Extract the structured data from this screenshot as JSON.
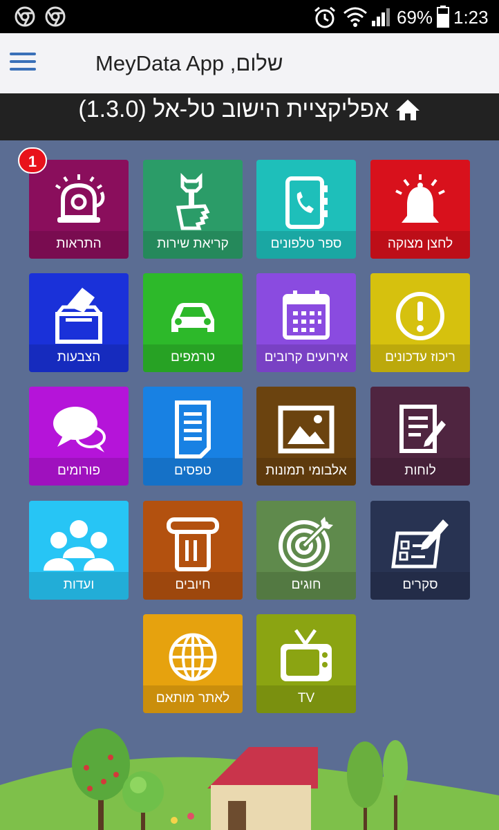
{
  "status_bar": {
    "battery": "69%",
    "time": "1:23"
  },
  "app_bar": {
    "title": "שלום, MeyData App"
  },
  "sub_header": {
    "title": "אפליקציית הישוב טל-אל (1.3.0)"
  },
  "badge": {
    "count": "1"
  },
  "tiles": [
    {
      "label": "לחצן מצוקה",
      "color": "#d8111c",
      "icon": "alarm-bell-icon"
    },
    {
      "label": "ספר טלפונים",
      "color": "#1ebfba",
      "icon": "phonebook-icon"
    },
    {
      "label": "קריאת שירות",
      "color": "#2b9c68",
      "icon": "wrench-hand-icon"
    },
    {
      "label": "התראות",
      "color": "#8a0e5c",
      "icon": "school-bell-icon"
    },
    {
      "label": "ריכוז עדכונים",
      "color": "#d6c10e",
      "icon": "exclamation-icon"
    },
    {
      "label": "אירועים קרובים",
      "color": "#8a4be0",
      "icon": "calendar-icon"
    },
    {
      "label": "טרמפים",
      "color": "#2db92a",
      "icon": "car-icon"
    },
    {
      "label": "הצבעות",
      "color": "#1a31d9",
      "icon": "ballot-box-icon"
    },
    {
      "label": "לוחות",
      "color": "#4f2540",
      "icon": "notepad-icon"
    },
    {
      "label": "אלבומי תמונות",
      "color": "#6b430f",
      "icon": "picture-icon"
    },
    {
      "label": "טפסים",
      "color": "#1881e3",
      "icon": "document-icon"
    },
    {
      "label": "פורומים",
      "color": "#b514d9",
      "icon": "speech-bubbles-icon"
    },
    {
      "label": "סקרים",
      "color": "#283352",
      "icon": "survey-icon"
    },
    {
      "label": "חוגים",
      "color": "#5f8a4c",
      "icon": "target-icon"
    },
    {
      "label": "חיובים",
      "color": "#b3510f",
      "icon": "receipt-icon"
    },
    {
      "label": "ועדות",
      "color": "#27c5f5",
      "icon": "group-icon"
    },
    {
      "label": "TV",
      "color": "#8ba412",
      "icon": "tv-icon"
    },
    {
      "label": "לאתר מותאם",
      "color": "#e6a20e",
      "icon": "globe-icon"
    }
  ]
}
